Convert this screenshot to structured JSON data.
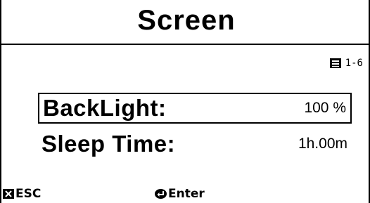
{
  "screen": {
    "title": "Screen"
  },
  "page_indicator": {
    "icon": "list-page-icon",
    "text": "1-6"
  },
  "menu": {
    "items": [
      {
        "label": "BackLight:",
        "value": "100 %",
        "selected": true
      },
      {
        "label": "Sleep Time:",
        "value": "1h.00m",
        "selected": false
      }
    ]
  },
  "footer": {
    "esc": {
      "icon": "esc-x-icon",
      "label": "ESC"
    },
    "enter": {
      "icon": "enter-return-icon",
      "label": "Enter"
    }
  }
}
